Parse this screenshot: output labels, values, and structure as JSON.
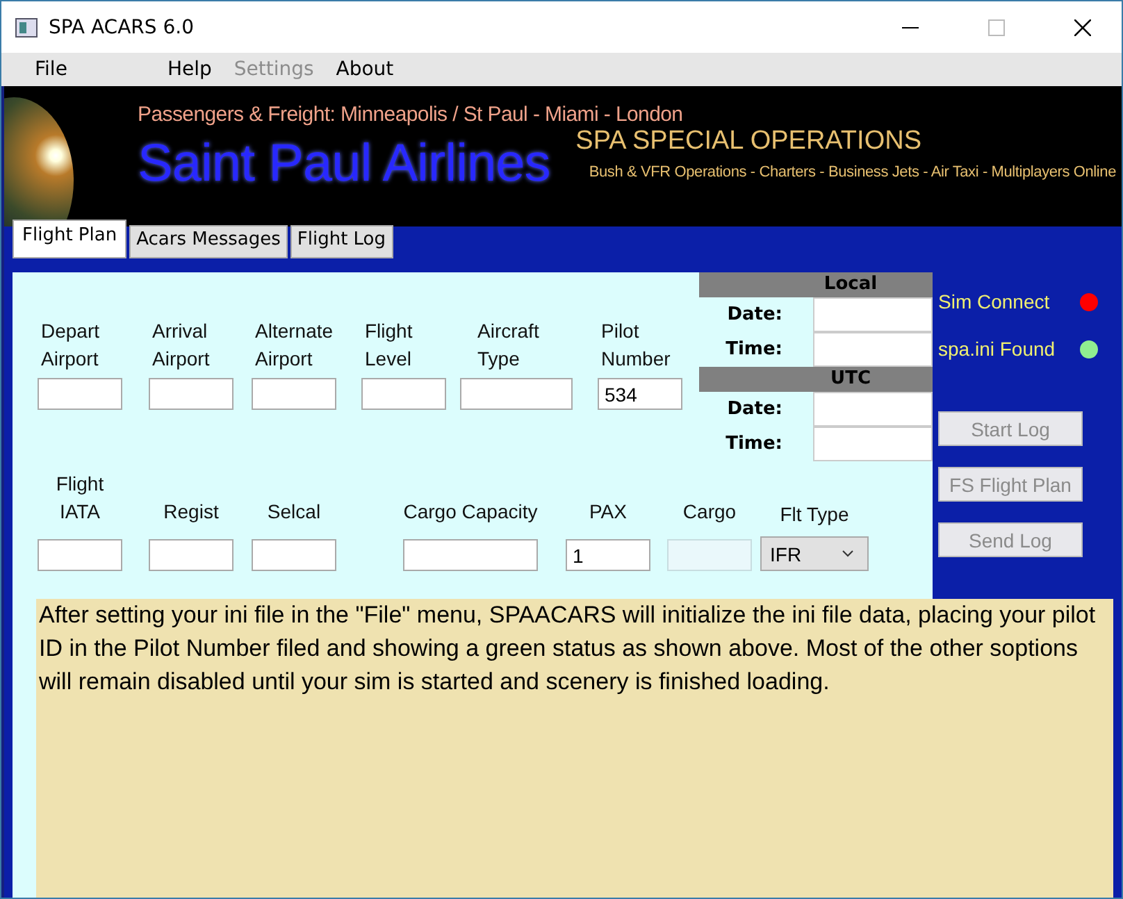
{
  "window": {
    "title": "SPA ACARS 6.0"
  },
  "menu": [
    {
      "label": "File",
      "disabled": false
    },
    {
      "label": "Help",
      "disabled": false
    },
    {
      "label": "Settings",
      "disabled": true
    },
    {
      "label": "About",
      "disabled": false
    }
  ],
  "banner": {
    "tagline": "Passengers & Freight: Minneapolis / St Paul - Miami - London",
    "airline": "Saint Paul Airlines",
    "division": "SPA SPECIAL OPERATIONS",
    "services": "Bush & VFR Operations - Charters - Business Jets - Air Taxi - Multiplayers Online"
  },
  "tabs": [
    {
      "label": "Flight Plan",
      "selected": true
    },
    {
      "label": "Acars Messages",
      "selected": false
    },
    {
      "label": "Flight Log",
      "selected": false
    }
  ],
  "fields_row_1": [
    {
      "label": "Depart Airport"
    },
    {
      "label": "Arrival Airport"
    },
    {
      "label": "Alternate Airport"
    },
    {
      "label": "Flight Level"
    },
    {
      "label": "Aircraft Type"
    },
    {
      "label": "Pilot Number",
      "value": "534"
    }
  ],
  "fields_row_2": [
    {
      "label": "Flight IATA",
      "kind": "text",
      "disabled": false
    },
    {
      "label": "Regist",
      "kind": "text",
      "disabled": false
    },
    {
      "label": "Selcal",
      "kind": "text",
      "disabled": false
    },
    {
      "label": "Cargo Capacity",
      "kind": "text",
      "disabled": false
    },
    {
      "label": "PAX",
      "value": "1",
      "kind": "text",
      "disabled": false
    },
    {
      "label": "Cargo",
      "kind": "text",
      "disabled": true
    },
    {
      "label": "Flt Type",
      "value": "IFR",
      "kind": "select",
      "disabled": false
    }
  ],
  "clock": [
    {
      "heading": "Local",
      "rows": [
        {
          "label": "Date:"
        },
        {
          "label": "Time:"
        }
      ]
    },
    {
      "heading": "UTC",
      "rows": [
        {
          "label": "Date:"
        },
        {
          "label": "Time:"
        }
      ]
    }
  ],
  "status": [
    {
      "label": "Sim Connect",
      "color": "#ff0000"
    },
    {
      "label": "spa.ini Found",
      "color": "#90ee90"
    }
  ],
  "buttons": [
    {
      "label": "Start Log",
      "disabled": true
    },
    {
      "label": "FS Flight Plan",
      "disabled": true
    },
    {
      "label": "Send Log",
      "disabled": true
    }
  ],
  "note": "After setting your ini file in the \"File\" menu, SPAACARS will initialize the ini file data, placing your pilot ID in the Pilot Number filed and showing a green status as shown above.  Most of the other soptions will remain disabled until your sim is started and scenery is finished loading."
}
